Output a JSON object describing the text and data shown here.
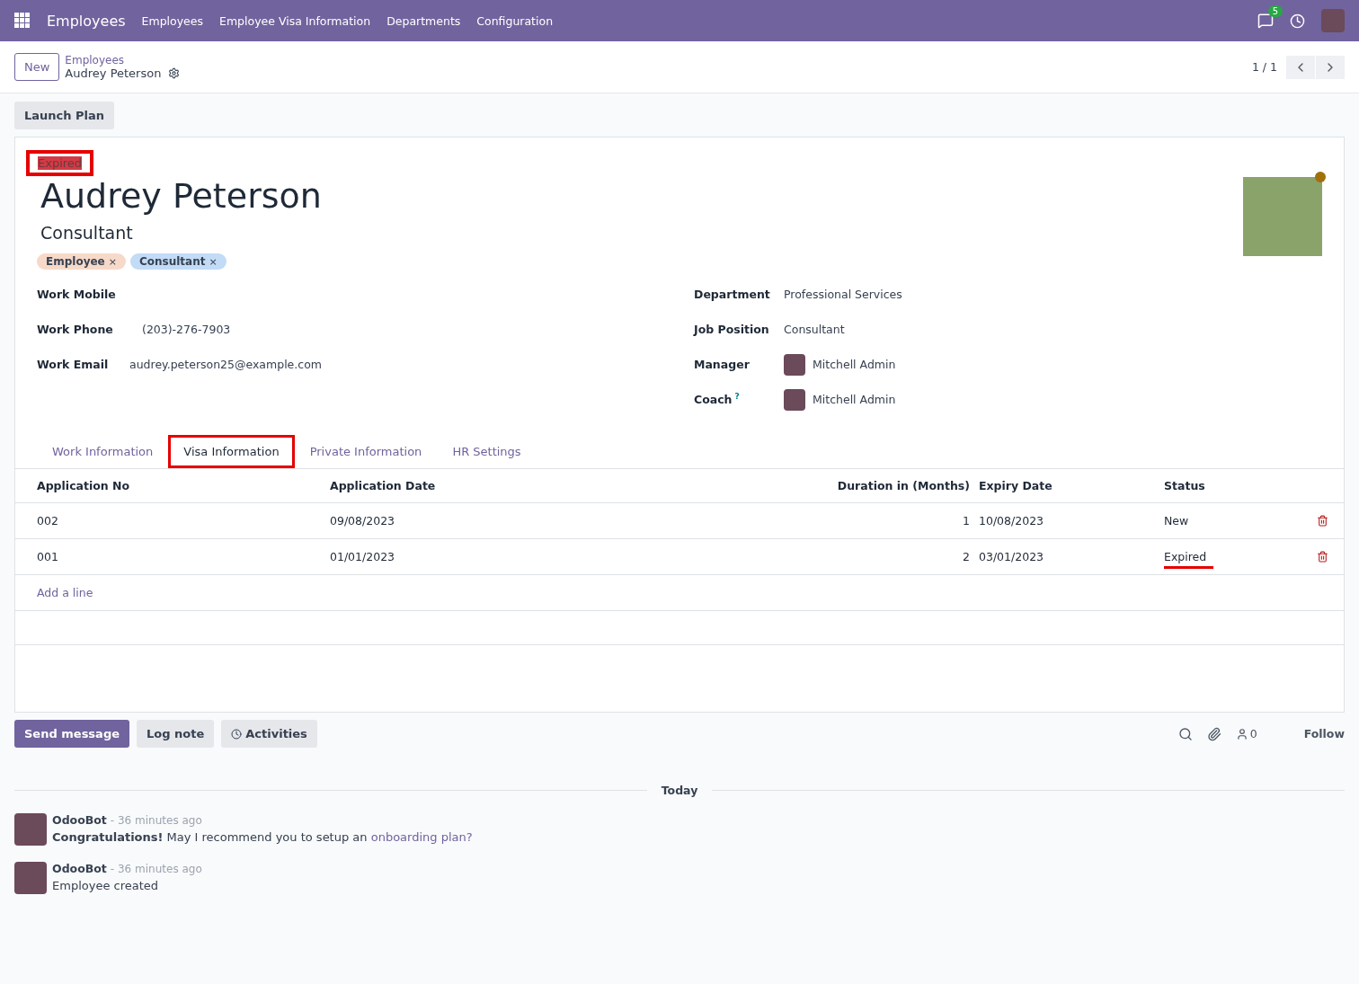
{
  "navbar": {
    "app": "Employees",
    "menus": [
      "Employees",
      "Employee Visa Information",
      "Departments",
      "Configuration"
    ],
    "message_count": "5"
  },
  "control_panel": {
    "new_button": "New",
    "breadcrumb_parent": "Employees",
    "breadcrumb_current": "Audrey Peterson",
    "pager": "1 / 1"
  },
  "actions": [
    "Launch Plan"
  ],
  "employee": {
    "visa_badge": "Expired",
    "badge_highlighted": true,
    "name": "Audrey Peterson",
    "job_title": "Consultant",
    "tags": [
      {
        "label": "Employee",
        "remove": "×",
        "color": "#f7d9c9"
      },
      {
        "label": "Consultant",
        "remove": "×",
        "color": "#c2dbf6"
      }
    ]
  },
  "left_fields": [
    {
      "label": "Work Mobile"
    },
    {
      "label": "Work Phone",
      "value": "(203)-276-7903"
    },
    {
      "label": "Work Email",
      "value": "audrey.peterson25@example.com"
    }
  ],
  "right_fields": [
    {
      "label": "Department",
      "value": "Professional Services",
      "kind": "text"
    },
    {
      "label": "Job Position",
      "value": "Consultant",
      "kind": "text"
    },
    {
      "label": "Manager",
      "value": "Mitchell Admin",
      "kind": "user"
    },
    {
      "label": "Coach",
      "help": "?",
      "value": "Mitchell Admin",
      "kind": "user"
    }
  ],
  "tabs": [
    {
      "label": "Work Information",
      "selected": false,
      "highlighted": false
    },
    {
      "label": "Visa Information",
      "selected": true,
      "highlighted": true
    },
    {
      "label": "Private Information",
      "selected": false,
      "highlighted": false
    },
    {
      "label": "HR Settings",
      "selected": false,
      "highlighted": false
    }
  ],
  "table": {
    "columns": [
      "Application No",
      "Application Date",
      "Duration in (Months)",
      "Expiry Date",
      "Status"
    ],
    "rows": [
      {
        "application_no": "002",
        "application_date": "09/08/2023",
        "duration": "1",
        "expiry_date": "10/08/2023",
        "status": "New",
        "status_underlined": false
      },
      {
        "application_no": "001",
        "application_date": "01/01/2023",
        "duration": "2",
        "expiry_date": "03/01/2023",
        "status": "Expired",
        "status_underlined": true
      }
    ],
    "add_line": "Add a line"
  },
  "chatter": {
    "buttons": [
      "Send message",
      "Log note",
      "Activities"
    ],
    "followers": "0",
    "follow": "Follow",
    "divider": "Today",
    "messages": [
      {
        "author": "OdooBot",
        "time": "- 36 minutes ago",
        "text": "**Congratulations!** May I recommend you to setup an",
        "link": "onboarding plan?"
      },
      {
        "author": "OdooBot",
        "time": "- 36 minutes ago",
        "text": "Employee created"
      }
    ]
  }
}
